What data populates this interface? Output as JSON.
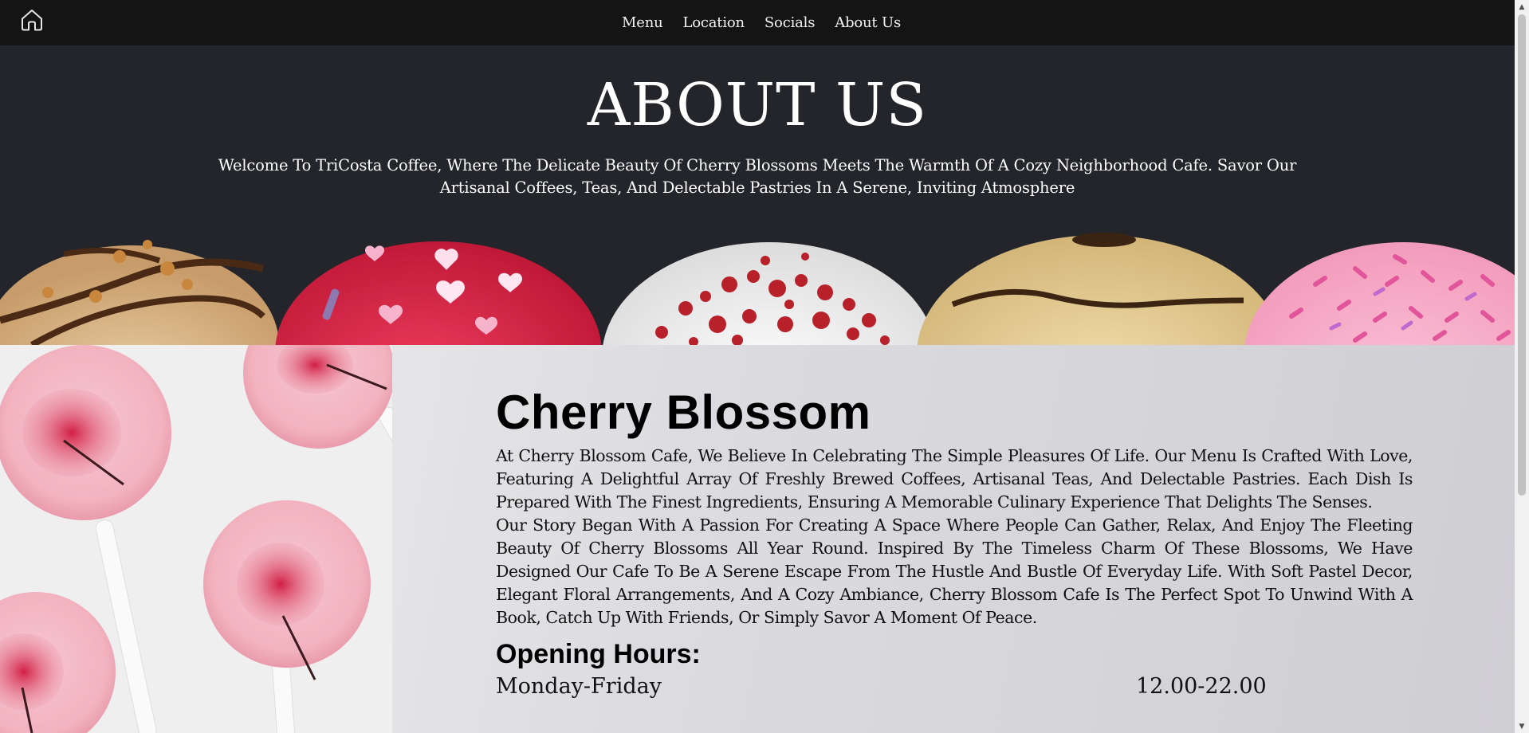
{
  "nav": {
    "home_icon": "home-icon",
    "links": [
      "Menu",
      "Location",
      "Socials",
      "About Us"
    ]
  },
  "hero": {
    "title": "ABOUT US",
    "text": "Welcome To TriCosta Coffee, Where The Delicate Beauty Of Cherry Blossoms Meets The Warmth Of A Cozy Neighborhood Cafe. Savor Our Artisanal Coffees, Teas, And Delectable Pastries In A Serene, Inviting Atmosphere"
  },
  "about": {
    "heading": "Cherry Blossom",
    "paragraphs": [
      "At Cherry Blossom Cafe, We Believe In Celebrating The Simple Pleasures Of Life. Our Menu Is Crafted With Love, Featuring A Delightful Array Of Freshly Brewed Coffees, Artisanal Teas, And Delectable Pastries. Each Dish Is Prepared With The Finest Ingredients, Ensuring A Memorable Culinary Experience That Delights The Senses.",
      "Our Story Began With A Passion For Creating A Space Where People Can Gather, Relax, And Enjoy The Fleeting Beauty Of Cherry Blossoms All Year Round. Inspired By The Timeless Charm Of These Blossoms, We Have Designed Our Cafe To Be A Serene Escape From The Hustle And Bustle Of Everyday Life. With Soft Pastel Decor, Elegant Floral Arrangements, And A Cozy Ambiance, Cherry Blossom Cafe Is The Perfect Spot To Unwind With A Book, Catch Up With Friends, Or Simply Savor A Moment Of Peace."
    ],
    "hours_heading": "Opening Hours:",
    "hours": [
      {
        "day": "Monday-Friday",
        "time": "12.00-22.00"
      }
    ]
  },
  "colors": {
    "nav_bg": "#141414",
    "hero_bg": "#23252b",
    "about_bg": "#dcdce0",
    "accent_pink": "#e8456a"
  }
}
